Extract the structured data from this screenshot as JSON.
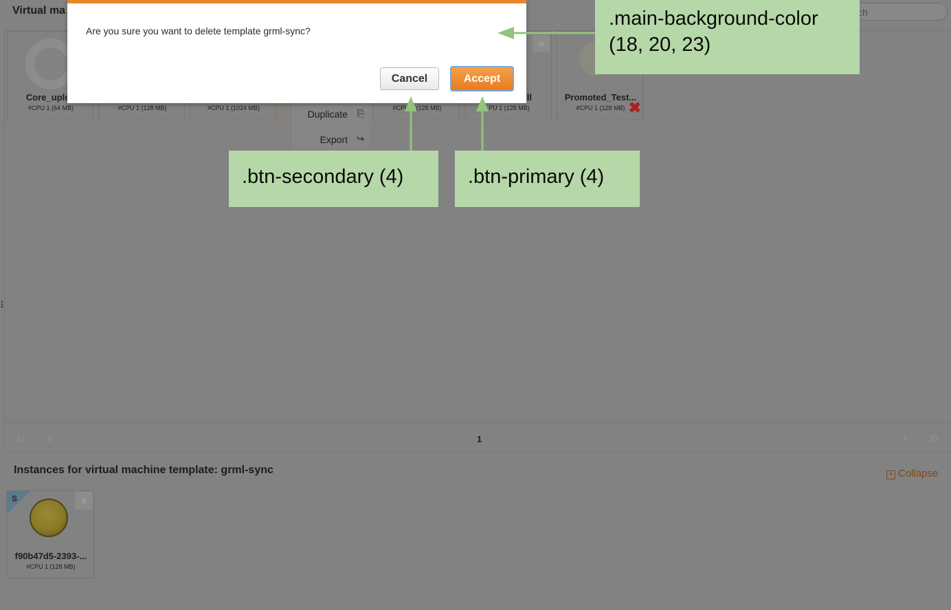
{
  "background_page": {
    "title": "Virtual ma",
    "search_placeholder": "ch",
    "side_mark": "⠇",
    "templates": [
      {
        "name": "Core_uplod",
        "spec": "#CPU 1 (64 MB)"
      },
      {
        "name": "",
        "spec": "#CPU 1 (128 MB)"
      },
      {
        "name": "",
        "spec": "#CPU 1 (1024 MB)"
      },
      {
        "name": "",
        "spec": "#CPU 1 (128 MB)"
      },
      {
        "name": "ll",
        "spec": "PU 1 (128 MB)"
      },
      {
        "name": "Promoted_Test...",
        "spec": "#CPU 1 (128 MB)"
      }
    ],
    "context_menu": {
      "duplicate": "Duplicate",
      "export": "Export"
    },
    "pagination": {
      "first": "«",
      "prev": "‹",
      "current_page": "1",
      "next": "›",
      "last": "»"
    },
    "instances": {
      "title": "Instances for virtual machine template: grml-sync",
      "collapse_label": "Collapse",
      "items": [
        {
          "badge": "S",
          "name": "f90b47d5-2393-...",
          "spec": "#CPU 1 (128 MB)"
        }
      ]
    }
  },
  "dialog": {
    "message": "Are you sure you want to delete template grml-sync?",
    "cancel_label": "Cancel",
    "accept_label": "Accept",
    "accent_color": "#e9862b"
  },
  "annotations": {
    "main_background": ".main-background-color\n(18, 20, 23)",
    "btn_secondary": ".btn-secondary (4)",
    "btn_primary": ".btn-primary (4)",
    "color": "#b6d7a8",
    "arrow_color": "#93c47d"
  },
  "icons": {
    "menu": "≡",
    "delete": "✖",
    "duplicate": "⎘",
    "export": "↪"
  }
}
